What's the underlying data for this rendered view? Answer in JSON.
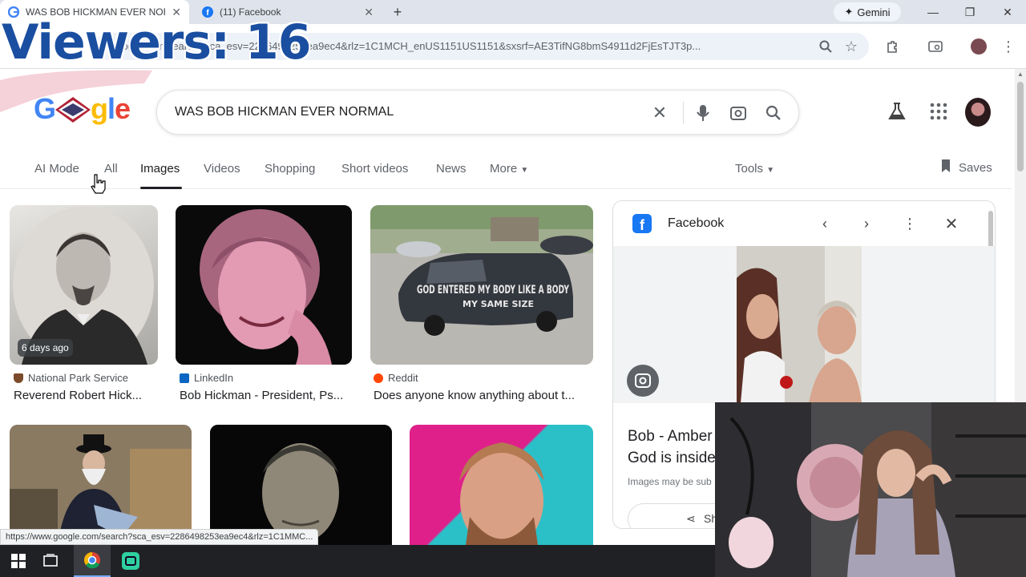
{
  "browser": {
    "tabs": [
      {
        "title": "WAS BOB HICKMAN EVER NOR",
        "active": true
      },
      {
        "title": "(11) Facebook",
        "active": false
      }
    ],
    "new_tab": "+",
    "gemini_label": "Gemini",
    "url": "google.com/search?sca_esv=2286498253ea9ec4&rlz=1C1MCH_enUS1151US1151&sxsrf=AE3TifNG8bmS4911d2FjEsTJT3p...",
    "status_url": "https://www.google.com/search?sca_esv=2286498253ea9ec4&rlz=1C1MMC..."
  },
  "overlay": {
    "viewers_text": "Viewers: 16"
  },
  "google": {
    "query": "WAS BOB HICKMAN EVER NORMAL",
    "nav": [
      "AI Mode",
      "All",
      "Images",
      "Videos",
      "Shopping",
      "Short videos",
      "News",
      "More"
    ],
    "active_nav": "Images",
    "tools": "Tools",
    "saves": "Saves"
  },
  "results": [
    {
      "badge": "6 days ago",
      "source": "National Park Service",
      "title": "Reverend Robert Hick..."
    },
    {
      "source": "LinkedIn",
      "title": "Bob Hickman - President, Ps..."
    },
    {
      "source": "Reddit",
      "title": "Does anyone know anything about t...",
      "van_text_1": "GOD ENTERED MY BODY LIKE A BODY",
      "van_text_2": "MY SAME SIZE"
    }
  ],
  "panel": {
    "source": "Facebook",
    "caption_line1": "Bob - Amber",
    "caption_line2": "God is inside",
    "note": "Images may be sub",
    "share": "Sh"
  },
  "colors": {
    "accent": "#1a73e8",
    "overlay_text": "#1a4ea0",
    "facebook": "#1877f2"
  }
}
